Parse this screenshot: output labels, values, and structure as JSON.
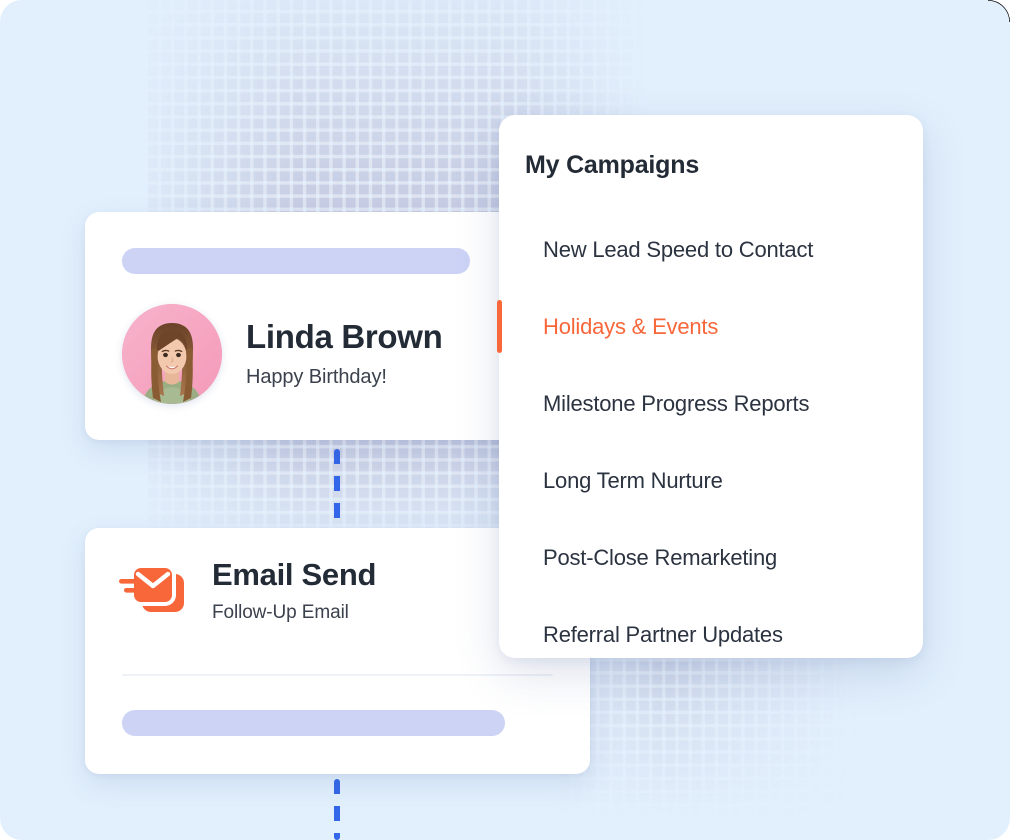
{
  "theme": {
    "background": "#e2f0fd",
    "accent_orange": "#f8673a",
    "accent_blue": "#3366e8",
    "placeholder_lavender": "#ccd3f5",
    "text_dark": "#232b36"
  },
  "contact_card": {
    "name": "Linda Brown",
    "subtitle": "Happy Birthday!",
    "avatar_alt": "woman-portrait-avatar"
  },
  "email_card": {
    "title": "Email Send",
    "subtitle": "Follow-Up Email",
    "icon": "email-send-icon"
  },
  "popup": {
    "title": "My Campaigns",
    "items": [
      {
        "label": "New Lead Speed to Contact",
        "active": false
      },
      {
        "label": "Holidays & Events",
        "active": true
      },
      {
        "label": "Milestone Progress Reports",
        "active": false
      },
      {
        "label": "Long Term Nurture",
        "active": false
      },
      {
        "label": "Post-Close Remarketing",
        "active": false
      },
      {
        "label": "Referral Partner Updates",
        "active": false
      }
    ]
  }
}
